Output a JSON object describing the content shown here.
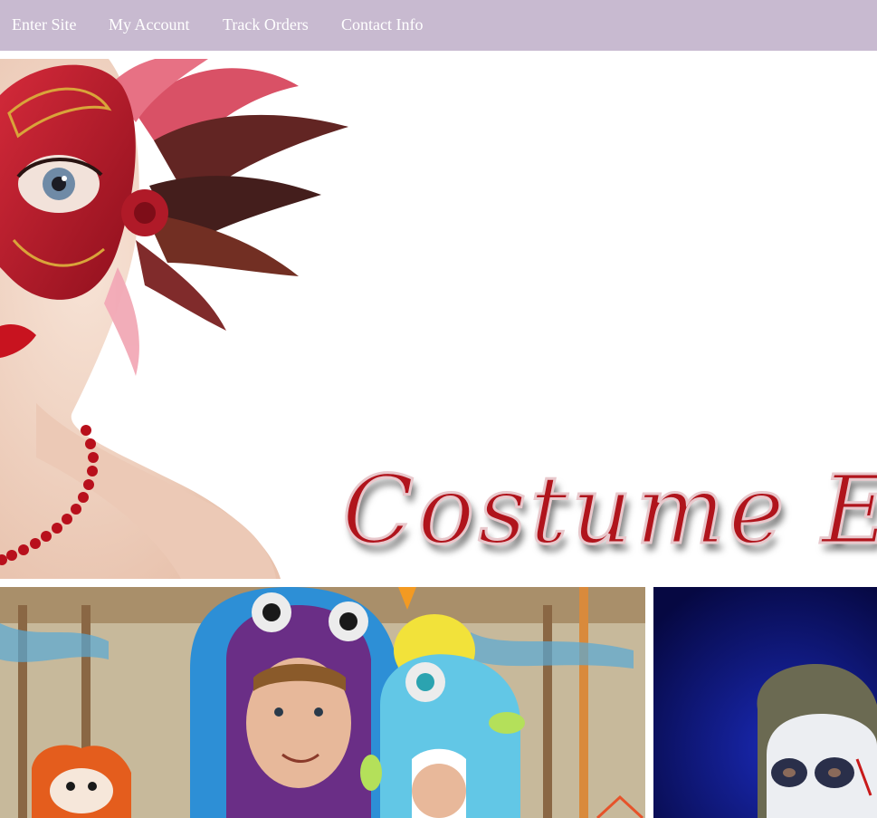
{
  "nav": {
    "items": [
      {
        "label": "Enter Site"
      },
      {
        "label": "My Account"
      },
      {
        "label": "Track Orders"
      },
      {
        "label": "Contact Info"
      }
    ]
  },
  "hero": {
    "title": "Costume Exp",
    "image": "woman-red-masquerade-mask"
  },
  "tiles": [
    {
      "image": "man-and-child-in-monster-costumes"
    },
    {
      "image": "boy-with-skull-face-paint"
    }
  ],
  "colors": {
    "nav_background": "#c8bad0",
    "nav_text": "#ffffff",
    "title_red": "#b0141c"
  }
}
